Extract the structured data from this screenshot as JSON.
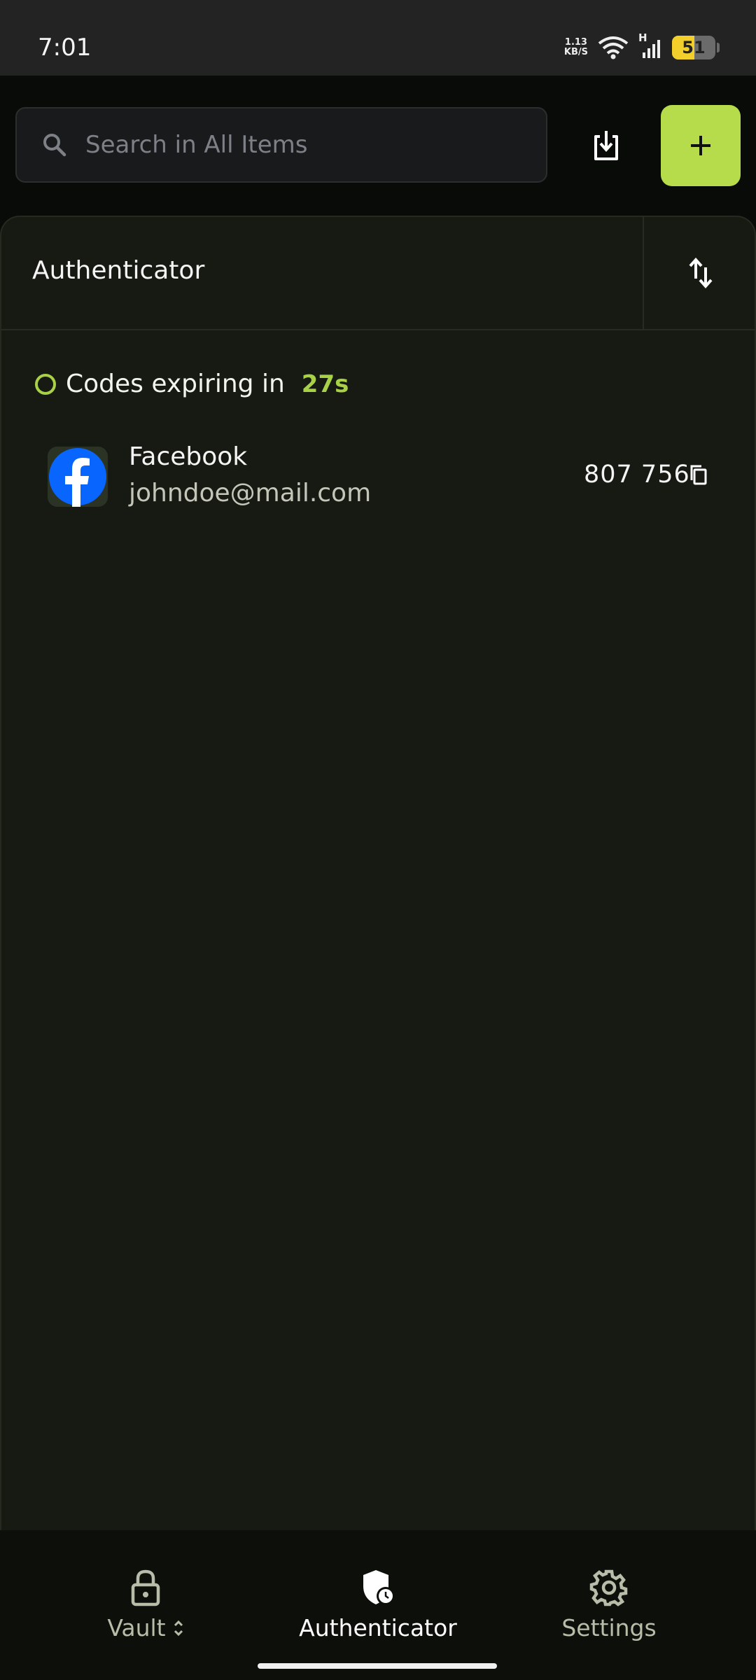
{
  "status_bar": {
    "time": "7:01",
    "net_speed_value": "1.13",
    "net_speed_unit": "KB/S",
    "network_type": "H",
    "battery": "51",
    "battery_level": 0.51
  },
  "search": {
    "placeholder": "Search in All Items",
    "value": ""
  },
  "panel": {
    "title": "Authenticator"
  },
  "expiry": {
    "label": "Codes expiring in",
    "seconds": "27s"
  },
  "items": [
    {
      "name": "Facebook",
      "email": "johndoe@mail.com",
      "code": "807 756",
      "logo": "facebook-logo"
    }
  ],
  "bottom_nav": {
    "vault": "Vault",
    "authenticator": "Authenticator",
    "settings": "Settings"
  },
  "colors": {
    "accent": "#b6dc4b",
    "background": "#171a13",
    "facebook": "#0866ff"
  }
}
